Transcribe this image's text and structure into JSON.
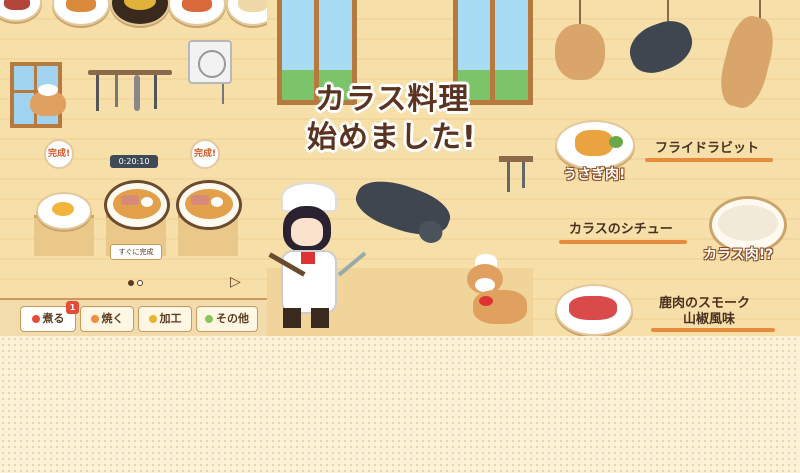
{
  "panel1": {
    "bubble_left": "完成!",
    "bubble_right": "完成!",
    "timer": "0:20:10",
    "instant_button": "すぐに完成",
    "tabs": [
      {
        "label": "煮る",
        "dot": "#e84a3a",
        "badge": "1"
      },
      {
        "label": "焼く",
        "dot": "#f08c3a"
      },
      {
        "label": "加工",
        "dot": "#e6b42e"
      },
      {
        "label": "その他",
        "dot": "#8cc45a"
      }
    ]
  },
  "panel2": {
    "title_line1": "カラス料理",
    "title_line2": "始めました!"
  },
  "panel3": {
    "dishes": [
      {
        "name": "フライドラビット",
        "tag": "うさぎ肉!"
      },
      {
        "name": "カラスのシチュー",
        "tag": "カラス肉!?"
      },
      {
        "name_line1": "鹿肉のスモーク",
        "name_line2": "山椒風味"
      }
    ]
  }
}
